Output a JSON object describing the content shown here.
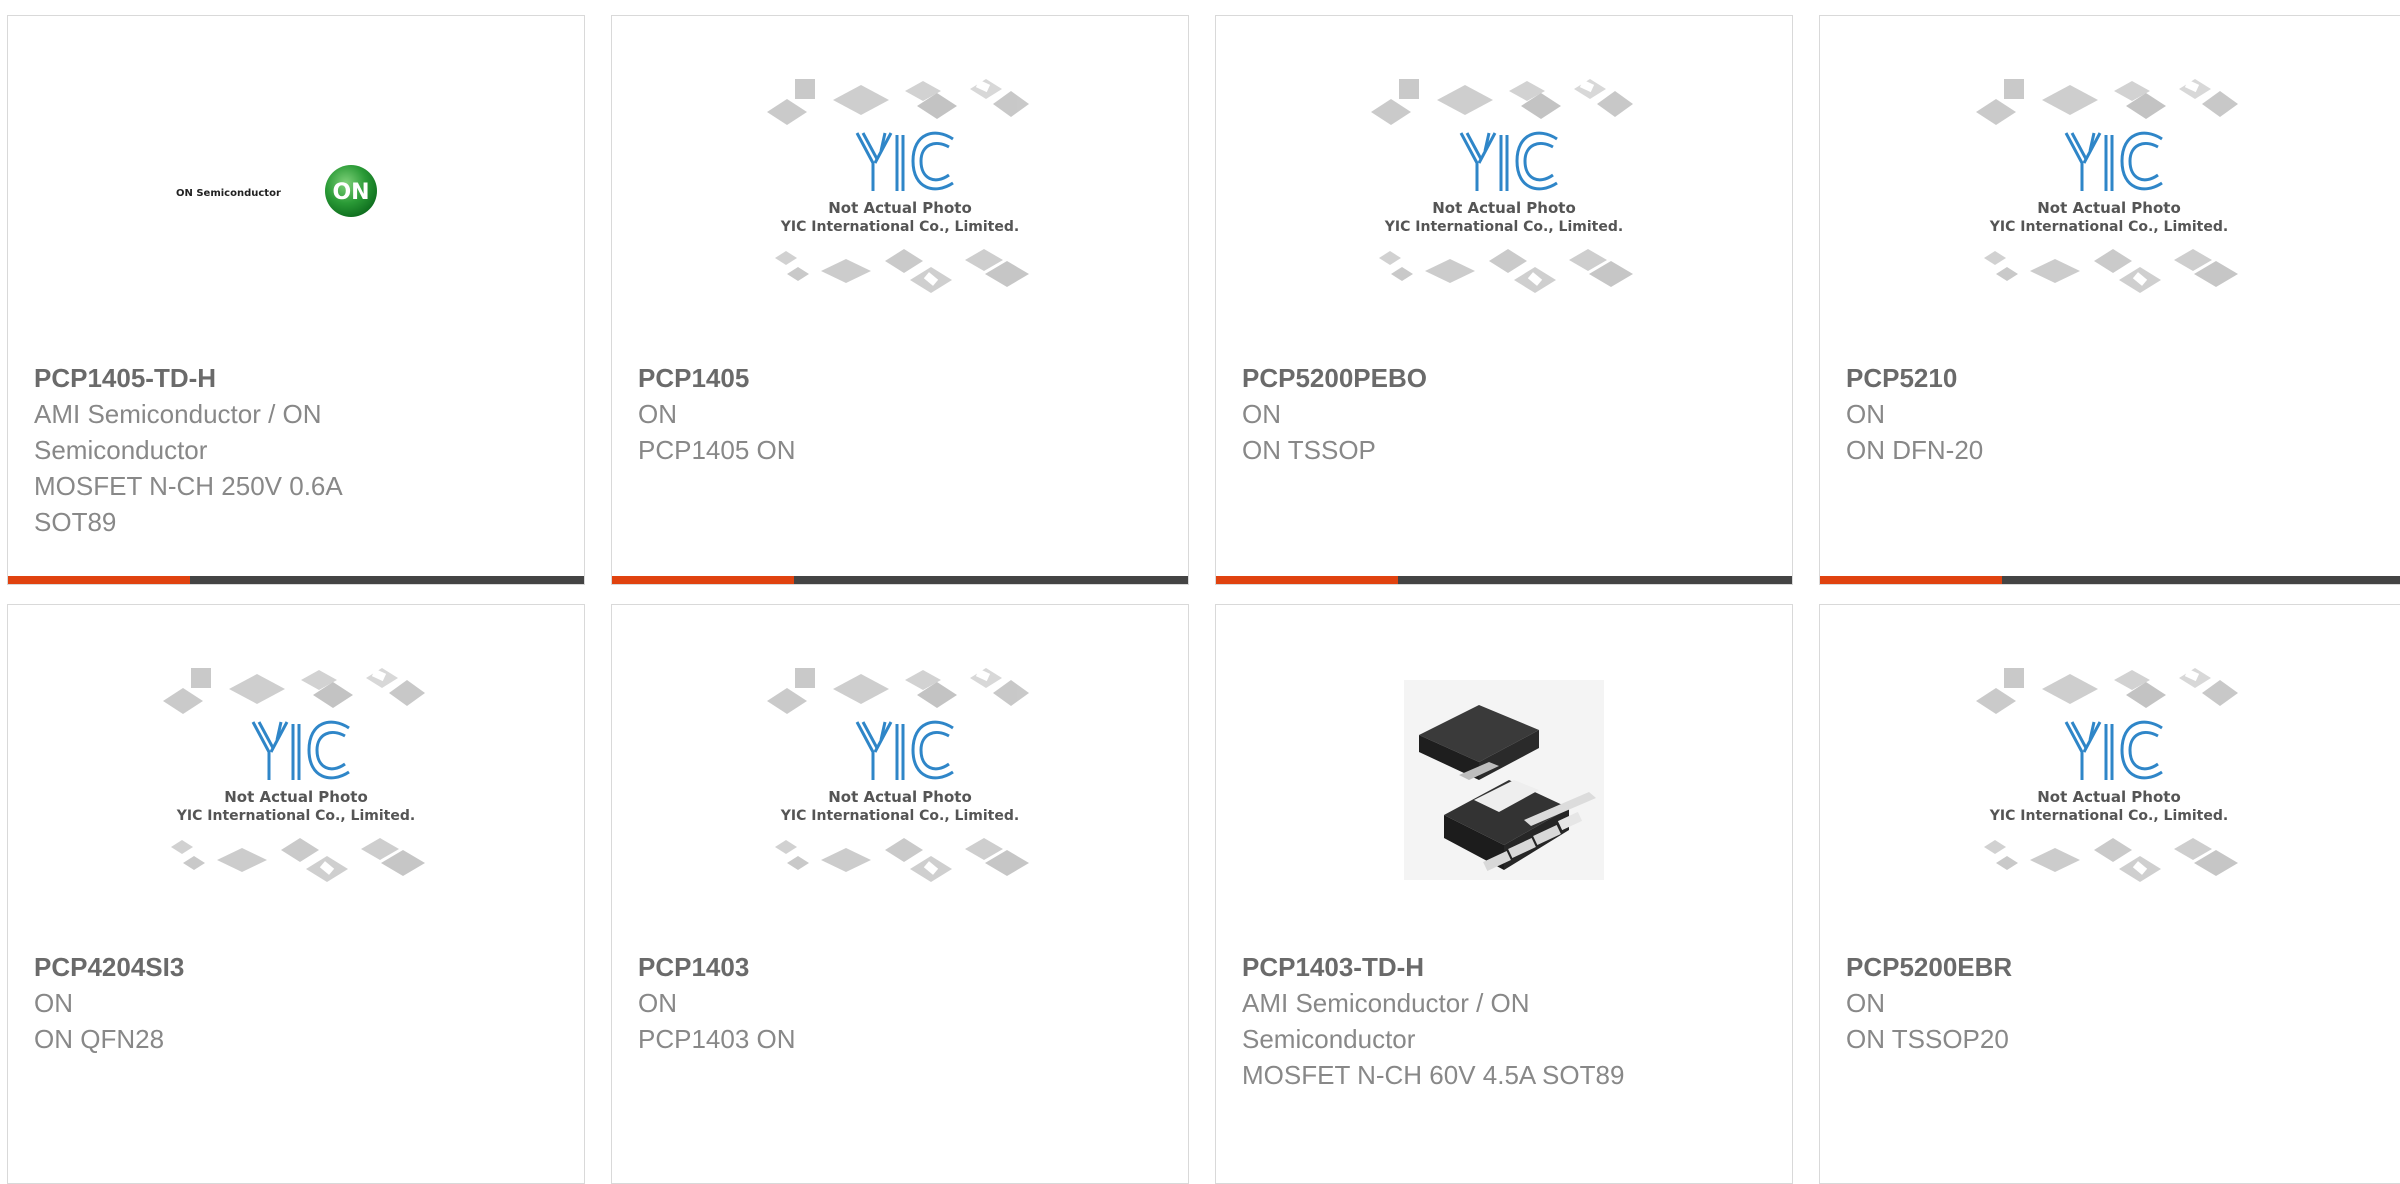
{
  "colors": {
    "accent": "#e0420f",
    "bar": "#444444",
    "card_border": "#d9d9d9",
    "text": "#888888",
    "title": "#6a6a6a"
  },
  "placeholder": {
    "line1": "Not Actual Photo",
    "line2": "YIC International Co., Limited.",
    "logo": "YIC"
  },
  "on_logo": {
    "brand_text": "ON Semiconductor",
    "badge": "ON"
  },
  "products": [
    {
      "part": "PCP1405-TD-H",
      "lines": [
        "AMI Semiconductor / ON",
        "Semiconductor",
        "MOSFET N-CH 250V 0.6A",
        "SOT89"
      ],
      "image": "on-semiconductor-logo"
    },
    {
      "part": "PCP1405",
      "lines": [
        "ON",
        "PCP1405 ON"
      ],
      "image": "yic-placeholder"
    },
    {
      "part": "PCP5200PEBO",
      "lines": [
        "ON",
        "ON TSSOP"
      ],
      "image": "yic-placeholder"
    },
    {
      "part": "PCP5210",
      "lines": [
        "ON",
        "ON DFN-20"
      ],
      "image": "yic-placeholder"
    },
    {
      "part": "PCP4204SI3",
      "lines": [
        "ON",
        "ON QFN28"
      ],
      "image": "yic-placeholder"
    },
    {
      "part": "PCP1403",
      "lines": [
        "ON",
        "PCP1403 ON"
      ],
      "image": "yic-placeholder"
    },
    {
      "part": "PCP1403-TD-H",
      "lines": [
        "AMI Semiconductor / ON",
        "Semiconductor",
        "MOSFET N-CH 60V 4.5A SOT89"
      ],
      "image": "sot89-package-photo"
    },
    {
      "part": "PCP5200EBR",
      "lines": [
        "ON",
        "ON TSSOP20"
      ],
      "image": "yic-placeholder"
    }
  ]
}
